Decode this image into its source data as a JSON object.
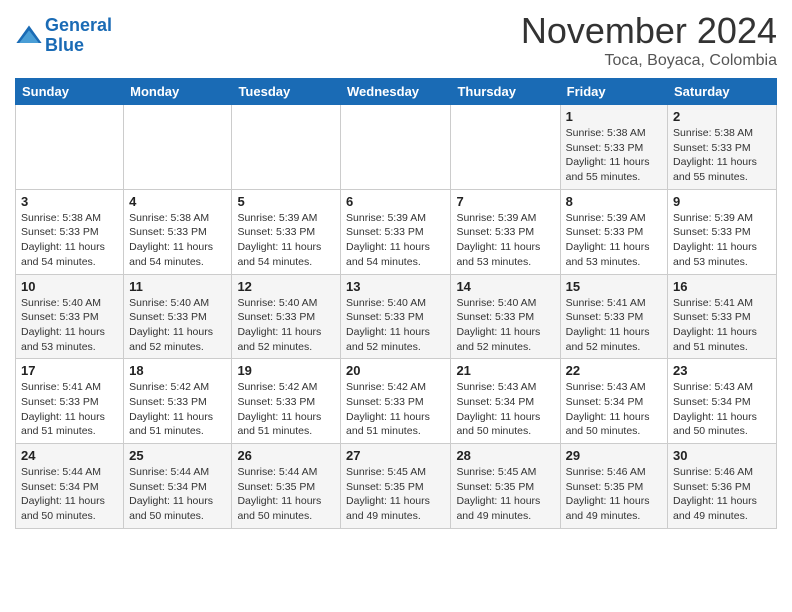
{
  "header": {
    "logo_line1": "General",
    "logo_line2": "Blue",
    "month": "November 2024",
    "location": "Toca, Boyaca, Colombia"
  },
  "weekdays": [
    "Sunday",
    "Monday",
    "Tuesday",
    "Wednesday",
    "Thursday",
    "Friday",
    "Saturday"
  ],
  "weeks": [
    [
      {
        "day": "",
        "info": ""
      },
      {
        "day": "",
        "info": ""
      },
      {
        "day": "",
        "info": ""
      },
      {
        "day": "",
        "info": ""
      },
      {
        "day": "",
        "info": ""
      },
      {
        "day": "1",
        "info": "Sunrise: 5:38 AM\nSunset: 5:33 PM\nDaylight: 11 hours and 55 minutes."
      },
      {
        "day": "2",
        "info": "Sunrise: 5:38 AM\nSunset: 5:33 PM\nDaylight: 11 hours and 55 minutes."
      }
    ],
    [
      {
        "day": "3",
        "info": "Sunrise: 5:38 AM\nSunset: 5:33 PM\nDaylight: 11 hours and 54 minutes."
      },
      {
        "day": "4",
        "info": "Sunrise: 5:38 AM\nSunset: 5:33 PM\nDaylight: 11 hours and 54 minutes."
      },
      {
        "day": "5",
        "info": "Sunrise: 5:39 AM\nSunset: 5:33 PM\nDaylight: 11 hours and 54 minutes."
      },
      {
        "day": "6",
        "info": "Sunrise: 5:39 AM\nSunset: 5:33 PM\nDaylight: 11 hours and 54 minutes."
      },
      {
        "day": "7",
        "info": "Sunrise: 5:39 AM\nSunset: 5:33 PM\nDaylight: 11 hours and 53 minutes."
      },
      {
        "day": "8",
        "info": "Sunrise: 5:39 AM\nSunset: 5:33 PM\nDaylight: 11 hours and 53 minutes."
      },
      {
        "day": "9",
        "info": "Sunrise: 5:39 AM\nSunset: 5:33 PM\nDaylight: 11 hours and 53 minutes."
      }
    ],
    [
      {
        "day": "10",
        "info": "Sunrise: 5:40 AM\nSunset: 5:33 PM\nDaylight: 11 hours and 53 minutes."
      },
      {
        "day": "11",
        "info": "Sunrise: 5:40 AM\nSunset: 5:33 PM\nDaylight: 11 hours and 52 minutes."
      },
      {
        "day": "12",
        "info": "Sunrise: 5:40 AM\nSunset: 5:33 PM\nDaylight: 11 hours and 52 minutes."
      },
      {
        "day": "13",
        "info": "Sunrise: 5:40 AM\nSunset: 5:33 PM\nDaylight: 11 hours and 52 minutes."
      },
      {
        "day": "14",
        "info": "Sunrise: 5:40 AM\nSunset: 5:33 PM\nDaylight: 11 hours and 52 minutes."
      },
      {
        "day": "15",
        "info": "Sunrise: 5:41 AM\nSunset: 5:33 PM\nDaylight: 11 hours and 52 minutes."
      },
      {
        "day": "16",
        "info": "Sunrise: 5:41 AM\nSunset: 5:33 PM\nDaylight: 11 hours and 51 minutes."
      }
    ],
    [
      {
        "day": "17",
        "info": "Sunrise: 5:41 AM\nSunset: 5:33 PM\nDaylight: 11 hours and 51 minutes."
      },
      {
        "day": "18",
        "info": "Sunrise: 5:42 AM\nSunset: 5:33 PM\nDaylight: 11 hours and 51 minutes."
      },
      {
        "day": "19",
        "info": "Sunrise: 5:42 AM\nSunset: 5:33 PM\nDaylight: 11 hours and 51 minutes."
      },
      {
        "day": "20",
        "info": "Sunrise: 5:42 AM\nSunset: 5:33 PM\nDaylight: 11 hours and 51 minutes."
      },
      {
        "day": "21",
        "info": "Sunrise: 5:43 AM\nSunset: 5:34 PM\nDaylight: 11 hours and 50 minutes."
      },
      {
        "day": "22",
        "info": "Sunrise: 5:43 AM\nSunset: 5:34 PM\nDaylight: 11 hours and 50 minutes."
      },
      {
        "day": "23",
        "info": "Sunrise: 5:43 AM\nSunset: 5:34 PM\nDaylight: 11 hours and 50 minutes."
      }
    ],
    [
      {
        "day": "24",
        "info": "Sunrise: 5:44 AM\nSunset: 5:34 PM\nDaylight: 11 hours and 50 minutes."
      },
      {
        "day": "25",
        "info": "Sunrise: 5:44 AM\nSunset: 5:34 PM\nDaylight: 11 hours and 50 minutes."
      },
      {
        "day": "26",
        "info": "Sunrise: 5:44 AM\nSunset: 5:35 PM\nDaylight: 11 hours and 50 minutes."
      },
      {
        "day": "27",
        "info": "Sunrise: 5:45 AM\nSunset: 5:35 PM\nDaylight: 11 hours and 49 minutes."
      },
      {
        "day": "28",
        "info": "Sunrise: 5:45 AM\nSunset: 5:35 PM\nDaylight: 11 hours and 49 minutes."
      },
      {
        "day": "29",
        "info": "Sunrise: 5:46 AM\nSunset: 5:35 PM\nDaylight: 11 hours and 49 minutes."
      },
      {
        "day": "30",
        "info": "Sunrise: 5:46 AM\nSunset: 5:36 PM\nDaylight: 11 hours and 49 minutes."
      }
    ]
  ]
}
